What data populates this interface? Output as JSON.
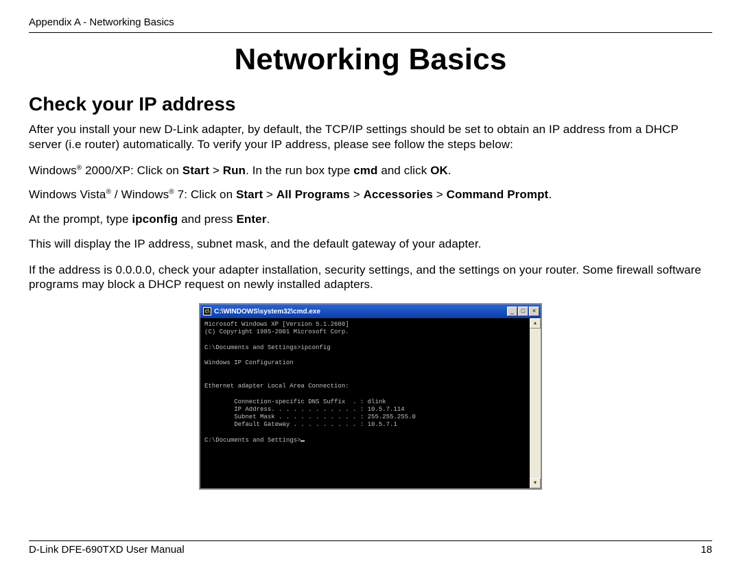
{
  "header": {
    "running": "Appendix A - Networking Basics"
  },
  "title": "Networking Basics",
  "subhead": "Check your IP address",
  "paragraphs": {
    "intro": "After you install your new D-Link adapter, by default, the TCP/IP settings should be set to obtain an IP address from a DHCP server (i.e router) automatically. To verify your IP address, please see follow the steps below:",
    "winxp_pre": "Windows",
    "winxp_post1": " 2000/XP: Click on ",
    "winxp_b1": "Start",
    "winxp_gt1": " > ",
    "winxp_b2": "Run",
    "winxp_post2": ". In the run box type ",
    "winxp_b3": "cmd",
    "winxp_post3": " and click ",
    "winxp_b4": "OK",
    "winxp_post4": ".",
    "vista_pre1": "Windows Vista",
    "vista_mid1": " / Windows",
    "vista_post1": " 7: Click on ",
    "vista_b1": "Start",
    "vista_gt1": " > ",
    "vista_b2": "All Programs",
    "vista_gt2": " > ",
    "vista_b3": "Accessories",
    "vista_gt3": " > ",
    "vista_b4": "Command Prompt",
    "vista_post2": ".",
    "prompt_pre": "At the prompt, type ",
    "prompt_b1": "ipconfig",
    "prompt_mid": " and press ",
    "prompt_b2": "Enter",
    "prompt_post": ".",
    "display": "This will display the IP address, subnet mask, and the default gateway of your adapter.",
    "zero": "If the address is 0.0.0.0, check your adapter installation, security settings, and the settings on your router. Some firewall software programs may block a DHCP request on newly installed adapters."
  },
  "cmd": {
    "title": "C:\\WINDOWS\\system32\\cmd.exe",
    "min": "_",
    "max": "□",
    "close": "×",
    "up": "▴",
    "down": "▾",
    "lines": "Microsoft Windows XP [Version 5.1.2600]\n(C) Copyright 1985-2001 Microsoft Corp.\n\nC:\\Documents and Settings>ipconfig\n\nWindows IP Configuration\n\n\nEthernet adapter Local Area Connection:\n\n        Connection-specific DNS Suffix  . : dlink\n        IP Address. . . . . . . . . . . . : 10.5.7.114\n        Subnet Mask . . . . . . . . . . . : 255.255.255.0\n        Default Gateway . . . . . . . . . : 10.5.7.1\n\nC:\\Documents and Settings>"
  },
  "footer": {
    "manual": "D-Link DFE-690TXD User Manual",
    "page": "18"
  },
  "reg": "®"
}
